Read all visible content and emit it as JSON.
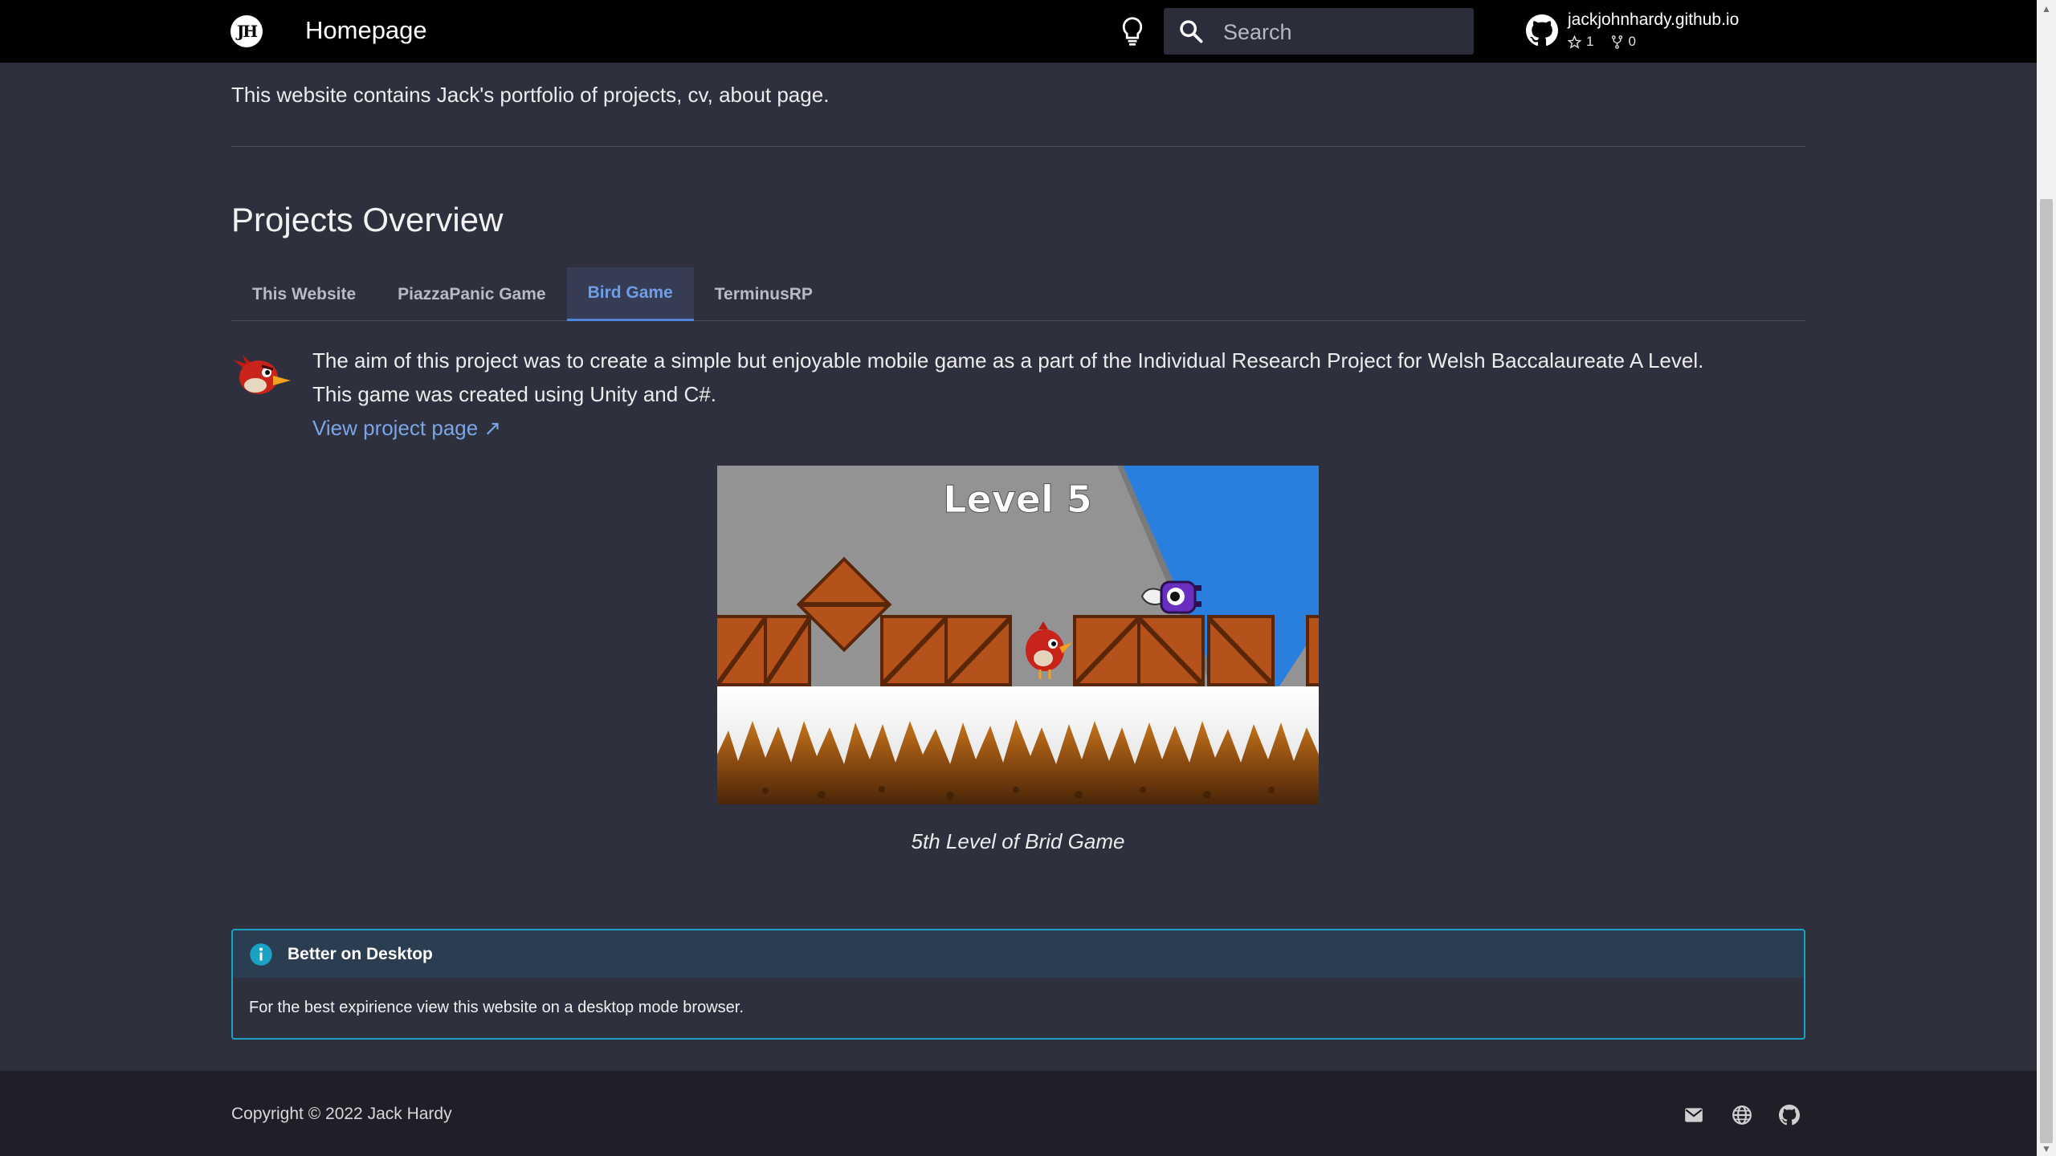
{
  "header": {
    "logo_text": "JH",
    "title": "Homepage",
    "search_placeholder": "Search",
    "repo": {
      "name": "jackjohnhardy.github.io",
      "stars": "1",
      "forks": "0"
    },
    "icons": [
      "lightbulb-icon",
      "search-icon",
      "github-icon",
      "star-icon",
      "fork-icon"
    ]
  },
  "intro": {
    "text": "This website contains Jack's portfolio of projects, cv, about page."
  },
  "projects": {
    "title": "Projects Overview",
    "tabs": [
      {
        "label": "This Website",
        "active": false
      },
      {
        "label": "PiazzaPanic Game",
        "active": false
      },
      {
        "label": "Bird Game",
        "active": true
      },
      {
        "label": "TerminusRP",
        "active": false
      }
    ],
    "active_panel": {
      "line1": "The aim of this project was to create a simple but enjoyable mobile game as a part of the Individual Research Project for Welsh Baccalaureate A Level.",
      "line2": "This game was created using Unity and C#.",
      "link_text": "View project page ↗",
      "figure_level_text": "Level 5",
      "caption": "5th Level of Brid Game"
    }
  },
  "admonition": {
    "title": "Better on Desktop",
    "body": "For the best expirience view this website on a desktop mode browser."
  },
  "footer": {
    "copyright": "Copyright © 2022 Jack Hardy",
    "icons": [
      "mail-icon",
      "globe-icon",
      "github-icon"
    ]
  },
  "colors": {
    "header_bg": "#000000",
    "page_bg": "#2e303e",
    "accent_blue": "#6e9ee8",
    "link": "#7aa5e6",
    "admonition_border": "#1aa1c4",
    "footer_bg": "#1f2027"
  }
}
